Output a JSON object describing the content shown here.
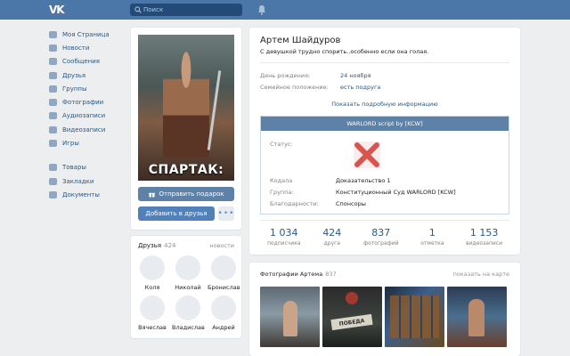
{
  "header": {
    "logo_text": "VK",
    "search_placeholder": "Поиск"
  },
  "nav": {
    "items": [
      "Моя Страница",
      "Новости",
      "Сообщения",
      "Друзья",
      "Группы",
      "Фотографии",
      "Аудиозаписи",
      "Видеозаписи",
      "Игры"
    ],
    "items2": [
      "Товары",
      "Закладки",
      "Документы"
    ]
  },
  "avatar": {
    "poster_title": "СПАРТАК:",
    "gift_label": "Отправить подарок",
    "add_friend_label": "Добавить в друзья",
    "more_label": "•••"
  },
  "friends": {
    "title": "Друзья",
    "count": "424",
    "updates_label": "новости",
    "list": [
      "Коля",
      "Николай",
      "Бронислав",
      "Вячеслав",
      "Владислав",
      "Андрей"
    ]
  },
  "profile": {
    "name": "Артем Шайдуров",
    "status": "С девушкой трудно спорить..особенно если она голая.",
    "birthday_label": "День рождения:",
    "birthday_value": "24 ноября",
    "family_label": "Семейное положение:",
    "family_value": "есть подруга",
    "more_info": "Показать подробную информацию"
  },
  "app": {
    "title": "WARLORD script by [KCW]",
    "status_label": "Статус:",
    "rows": [
      {
        "label": "Кодала",
        "value": "Доказательство 1"
      },
      {
        "label": "Группа:",
        "value": "Конституционный Суд WARLORD [KCW]"
      },
      {
        "label": "Благодарности:",
        "value": "Спонсоры"
      }
    ]
  },
  "counters": [
    {
      "num": "1 034",
      "label": "подписчика"
    },
    {
      "num": "424",
      "label": "друга"
    },
    {
      "num": "837",
      "label": "фотографий"
    },
    {
      "num": "1",
      "label": "отметка"
    },
    {
      "num": "1 153",
      "label": "видеозаписи"
    }
  ],
  "photos": {
    "title": "Фотографии Артема",
    "count": "837",
    "map_label": "показать на карте",
    "tag_text": "ПОБЕДА"
  },
  "colors": {
    "header": "#4a76a8",
    "link": "#2a5885",
    "button": "#5181b8",
    "x_mark": "#d9534f"
  }
}
